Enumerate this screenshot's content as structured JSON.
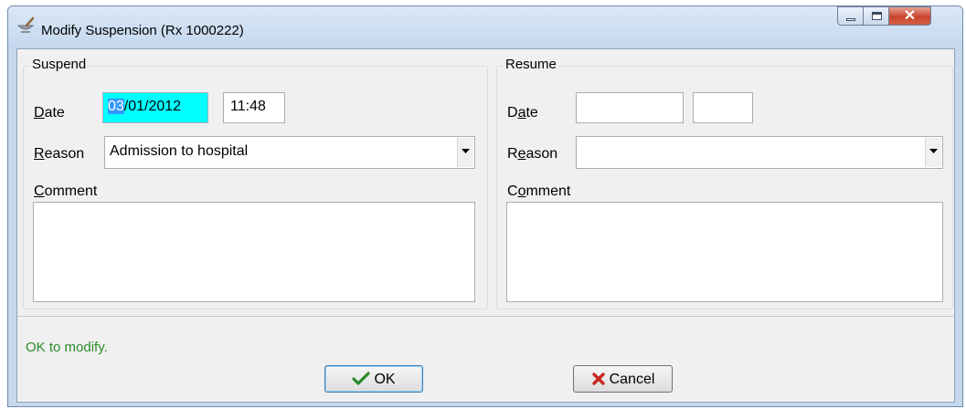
{
  "window": {
    "title": "Modify Suspension (Rx 1000222)"
  },
  "suspend": {
    "group_label": "Suspend",
    "date_label": "Date",
    "date_value_selected": "03",
    "date_value_rest": "/01/2012",
    "time_value": "11:48",
    "reason_label": "Reason",
    "reason_value": "Admission to hospital",
    "comment_label": "Comment",
    "comment_value": ""
  },
  "resume": {
    "group_label": "Resume",
    "date_label": "Date",
    "date_value": "",
    "time_value": "",
    "reason_label": "Reason",
    "reason_value": "",
    "comment_label": "Comment",
    "comment_value": ""
  },
  "status": {
    "message": "OK to modify.",
    "color": "#2a8a2a"
  },
  "buttons": {
    "ok_label": "OK",
    "cancel_label": "Cancel"
  },
  "colors": {
    "date_field_highlight": "#00ffff",
    "selection": "#3399ff",
    "check": "#2a8a2a",
    "cross": "#c8281e"
  },
  "icons": {
    "window": "mortar-pestle-icon",
    "ok": "checkmark-icon",
    "cancel": "x-icon",
    "dropdown": "chevron-down-icon"
  }
}
